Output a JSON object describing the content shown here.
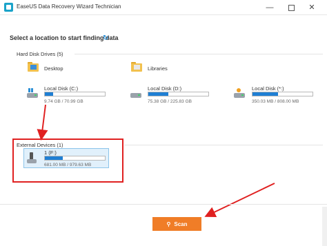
{
  "window": {
    "title": "EaseUS Data Recovery Wizard Technician",
    "minimize_glyph": "—",
    "close_glyph": "✕"
  },
  "main": {
    "heading": "Select a location to start finding data",
    "refresh_glyph": "↻"
  },
  "hard_disk_drives": {
    "label": "Hard Disk Drives (5)",
    "locations": [
      {
        "label": "Desktop",
        "icon": "desktop-folder-icon"
      },
      {
        "label": "Libraries",
        "icon": "libraries-folder-icon"
      }
    ],
    "drives": [
      {
        "name": "Local Disk (C:)",
        "size": "9.74 GB / 70.99 GB",
        "used_fraction": 0.14,
        "icon": "windows-drive-icon"
      },
      {
        "name": "Local Disk (D:)",
        "size": "75.38 GB / 225.83 GB",
        "used_fraction": 0.33,
        "icon": "hard-drive-icon"
      },
      {
        "name": "Local Disk (*:)",
        "size": "350.03 MB / 808.00 MB",
        "used_fraction": 0.43,
        "icon": "system-drive-icon"
      }
    ]
  },
  "external_devices": {
    "label": "External Devices (1)",
    "devices": [
      {
        "name": "1 (F:)",
        "size": "681.00 MB / 979.63 MB",
        "used_fraction": 0.3,
        "icon": "usb-drive-icon"
      }
    ]
  },
  "footer": {
    "scan_label": "Scan",
    "scan_icon": "search-icon",
    "scan_glyph": "⚲"
  },
  "colors": {
    "accent_blue": "#1f7fd4",
    "scan_orange": "#f07d27",
    "annotation_red": "#e02020",
    "selection_bg": "#e1f0fb"
  }
}
